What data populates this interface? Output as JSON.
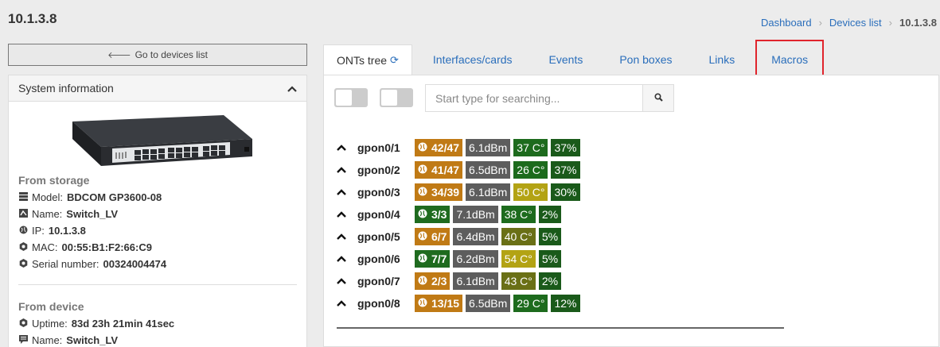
{
  "page": {
    "title": "10.1.3.8"
  },
  "breadcrumb": {
    "dashboard": "Dashboard",
    "devices_list": "Devices list",
    "current": "10.1.3.8"
  },
  "go_back": {
    "label": "Go to devices list"
  },
  "system_info": {
    "header": "System information",
    "from_storage_title": "From storage",
    "model_label": "Model:",
    "model_value": "BDCOM GP3600-08",
    "name_label": "Name:",
    "name_value": "Switch_LV",
    "ip_label": "IP:",
    "ip_value": "10.1.3.8",
    "mac_label": "MAC:",
    "mac_value": "00:55:B1:F2:66:C9",
    "serial_label": "Serial number:",
    "serial_value": "00324004474",
    "from_device_title": "From device",
    "uptime_label": "Uptime:",
    "uptime_value": "83d 23h 21min 41sec",
    "dev_name_label": "Name:",
    "dev_name_value": "Switch_LV"
  },
  "tabs": {
    "onts_tree": "ONTs tree",
    "interfaces": "Interfaces/cards",
    "events": "Events",
    "pon_boxes": "Pon boxes",
    "links": "Links",
    "macros": "Macros"
  },
  "search": {
    "placeholder": "Start type for searching..."
  },
  "colors": {
    "accent": "#2a6ebb",
    "highlight": "#e0242c",
    "onu_warn": "#c07a15",
    "onu_ok": "#1f6b1f"
  },
  "pon_ports": [
    {
      "name": "gpon0/1",
      "onu": "42/47",
      "onu_status": "orange",
      "signal": "6.1dBm",
      "temp": "37 C°",
      "temp_level": "ok",
      "load": "37%"
    },
    {
      "name": "gpon0/2",
      "onu": "41/47",
      "onu_status": "orange",
      "signal": "6.5dBm",
      "temp": "26 C°",
      "temp_level": "ok",
      "load": "37%"
    },
    {
      "name": "gpon0/3",
      "onu": "34/39",
      "onu_status": "orange",
      "signal": "6.1dBm",
      "temp": "50 C°",
      "temp_level": "warn",
      "load": "30%"
    },
    {
      "name": "gpon0/4",
      "onu": "3/3",
      "onu_status": "green",
      "signal": "7.1dBm",
      "temp": "38 C°",
      "temp_level": "ok",
      "load": "2%"
    },
    {
      "name": "gpon0/5",
      "onu": "6/7",
      "onu_status": "orange",
      "signal": "6.4dBm",
      "temp": "40 C°",
      "temp_level": "mid",
      "load": "5%"
    },
    {
      "name": "gpon0/6",
      "onu": "7/7",
      "onu_status": "green",
      "signal": "6.2dBm",
      "temp": "54 C°",
      "temp_level": "warn",
      "load": "5%"
    },
    {
      "name": "gpon0/7",
      "onu": "2/3",
      "onu_status": "orange",
      "signal": "6.1dBm",
      "temp": "43 C°",
      "temp_level": "mid",
      "load": "2%"
    },
    {
      "name": "gpon0/8",
      "onu": "13/15",
      "onu_status": "orange",
      "signal": "6.5dBm",
      "temp": "29 C°",
      "temp_level": "ok",
      "load": "12%"
    }
  ]
}
